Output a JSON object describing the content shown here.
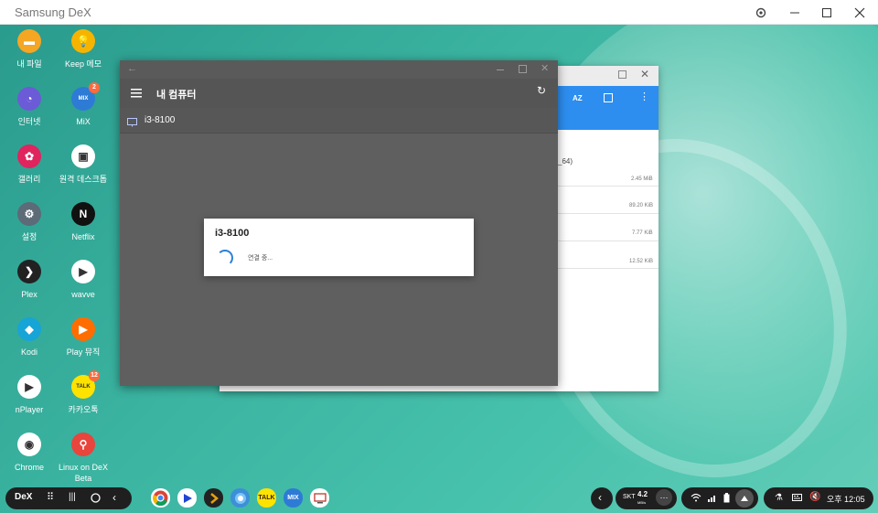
{
  "host": {
    "title": "Samsung DeX"
  },
  "desktop_icons": [
    {
      "label": "내 파일",
      "icon": "folder-icon",
      "color": "#f5a623",
      "glyph": "▬"
    },
    {
      "label": "Keep 메모",
      "icon": "lightbulb-icon",
      "color": "#f6b400",
      "glyph": "💡"
    },
    {
      "label": "인터넷",
      "icon": "internet-icon",
      "color": "#6b5bd6",
      "glyph": "◔"
    },
    {
      "label": "MiX",
      "icon": "mix-icon",
      "color": "#2e7bd6",
      "glyph": "MIX",
      "badge": "2"
    },
    {
      "label": "갤러리",
      "icon": "gallery-icon",
      "color": "#e0245e",
      "glyph": "✿"
    },
    {
      "label": "원격 데스크톱",
      "icon": "remote-desktop-icon",
      "color": "#ffffff",
      "glyph": "▣"
    },
    {
      "label": "설정",
      "icon": "settings-gear-icon",
      "color": "#5d6a78",
      "glyph": "⚙"
    },
    {
      "label": "Netflix",
      "icon": "netflix-icon",
      "color": "#111111",
      "glyph": "N"
    },
    {
      "label": "Plex",
      "icon": "plex-icon",
      "color": "#222222",
      "glyph": "❯"
    },
    {
      "label": "wavve",
      "icon": "wavve-icon",
      "color": "#ffffff",
      "glyph": "▶"
    },
    {
      "label": "Kodi",
      "icon": "kodi-icon",
      "color": "#17a4d6",
      "glyph": "◆"
    },
    {
      "label": "Play 뮤직",
      "icon": "play-music-icon",
      "color": "#ff6d00",
      "glyph": "▶"
    },
    {
      "label": "nPlayer",
      "icon": "nplayer-icon",
      "color": "#ffffff",
      "glyph": "▶"
    },
    {
      "label": "카카오톡",
      "icon": "kakaotalk-icon",
      "color": "#ffe300",
      "glyph": "TALK",
      "badge": "12"
    },
    {
      "label": "Chrome",
      "icon": "chrome-icon",
      "color": "#ffffff",
      "glyph": "◉"
    },
    {
      "label": "Linux on DeX Beta",
      "icon": "linux-on-dex-icon",
      "color": "#e8453c",
      "glyph": "⚲"
    }
  ],
  "back_window": {
    "toolbar": {
      "sort_label": "AZ"
    },
    "path_fragment": "_64)",
    "sizes": [
      "2.45 MiB",
      "89.20 KiB",
      "7.77 KiB",
      "12.52 KiB"
    ]
  },
  "front_window": {
    "title": "내 컴퓨터",
    "computer_name": "i3-8100"
  },
  "dialog": {
    "title": "i3-8100",
    "message": "연결 중..."
  },
  "taskbar": {
    "dex_label": "DeX",
    "carrier": "SKT",
    "speed_value": "4.2",
    "speed_unit": "MB/s",
    "time": "오후 12:05",
    "tray_apps": [
      "chrome-icon",
      "wavve-icon",
      "plex-icon",
      "browser-icon",
      "kakaotalk-icon",
      "mix-icon",
      "remote-desktop-icon"
    ]
  },
  "colors": {
    "accent_blue": "#2d8ef0",
    "window_gray": "#5f5f5f",
    "taskbar": "#1f1f1f"
  }
}
